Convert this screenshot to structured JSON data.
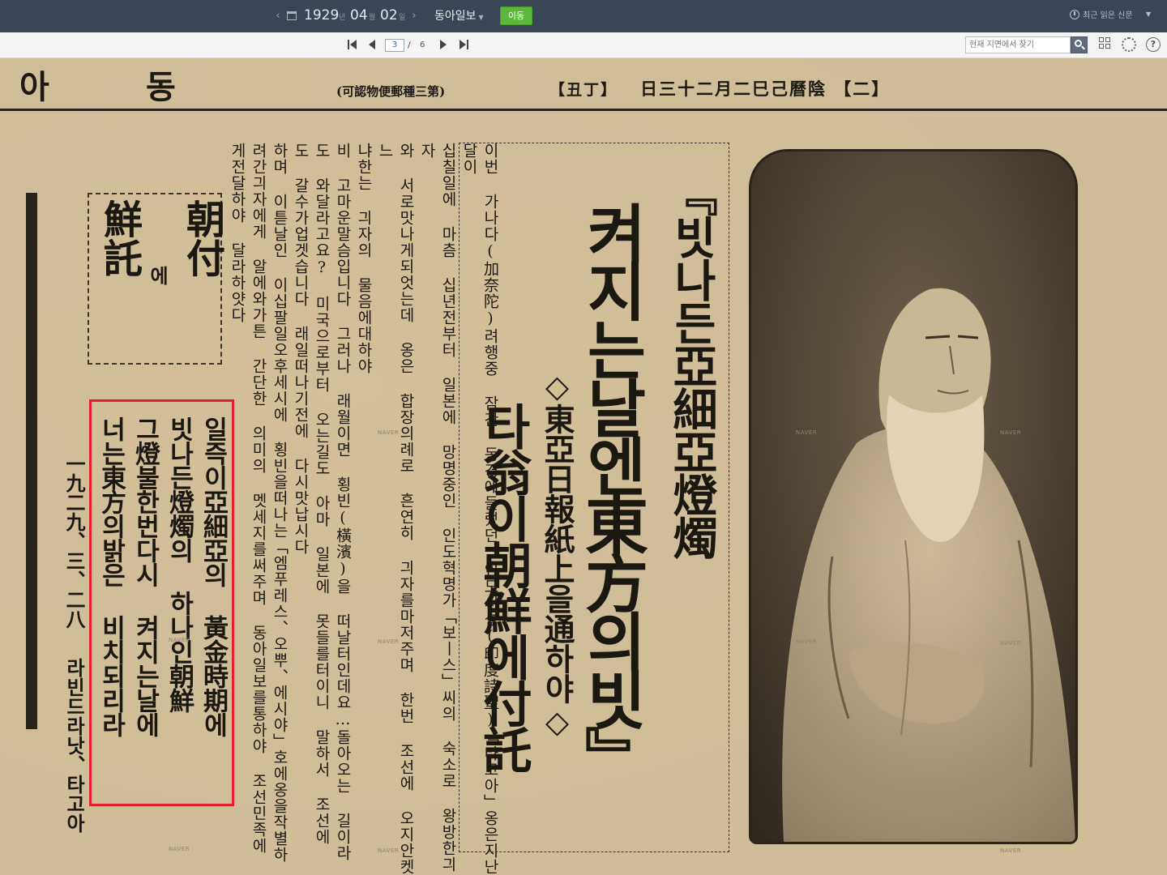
{
  "top_bar": {
    "prev_arrow": "‹",
    "next_arrow": "›",
    "year": "1929",
    "year_unit": "년",
    "month": "04",
    "month_unit": "월",
    "day": "02",
    "day_unit": "일",
    "newspaper": "동아일보",
    "go_button": "이동",
    "recent_papers": "최근 읽은 신문"
  },
  "toolbar": {
    "current_page": "3",
    "separator": "/",
    "total_pages": "6",
    "search_placeholder": "현재 지면에서 찾기"
  },
  "scan": {
    "masthead_logo_left": "아",
    "masthead_logo_mid": "동",
    "masthead_note": "(可認物便郵種三第)",
    "masthead_date": "日三十二月二巳己曆陰 【二】",
    "masthead_weekday": "【丑丁】",
    "headline_main_1": "『빗나든亞細亞燈燭",
    "headline_main_2": "켜지는날엔東方의빗』",
    "headline_sub": "◇東亞日報紙上을通하야◇",
    "headline_main_3": "타翁이朝鮮에付託",
    "body_columns": [
      "이번 가나다(加奈陀)려행중 잠간 동경에들렀던 인도시성(印度詩聖)「타고아」옹은지난달이",
      "십칠일에 마츰 십년전부터 일본에 망명중인 인도혁명가「보ㅣ스」씨의 숙소로 왕방한긔자",
      "와 서로맛나게되엇는데 옹은 합장의례로 흔연히 긔자를마저주며 한번 조선에 오지안켓느",
      "냐한는 긔자의 물음에대하야",
      "비 고마운말슴입니다 그러나 래월이면 횡빈(橫濱)을 떠날터인데요…돌아오는 길이라",
      "도 와달라고요? 미국으로부터 오는길도 아마 일본에 못들를터이니 말하서 조선에",
      "도 갈수가업겟습니다 래일떠나기전에 다시맛납시다",
      "하며 이튿날인 이십팔일오후세시에 횡빈을떠나는「엠푸레스、오뿌、에시야」호에옹을작별하",
      "려간긔자에게 알에와가튼 간단한 의미의 멧세지를써주며 동아일보를통하야 조선민족에",
      "게전달하야 달라하얏다"
    ],
    "box_title_col1": "朝付",
    "box_title_mid": "에",
    "box_title_col2": "鮮託",
    "poem_lines": [
      "일즉이亞細亞의 黃金時期에",
      "빗나든燈燭의 하나인朝鮮",
      "그燈불한번다시 켜지는날에",
      "너는東方의밝은 비치되리라"
    ],
    "poem_date": "一九二九、三、二八",
    "poem_author": "라빈드라낫、타고아",
    "watermark": "NAVER",
    "colors": {
      "highlight": "#e3202a",
      "go_button": "#5cb83a",
      "top_bar": "#3a4556",
      "paper": "#d3c29c"
    }
  }
}
